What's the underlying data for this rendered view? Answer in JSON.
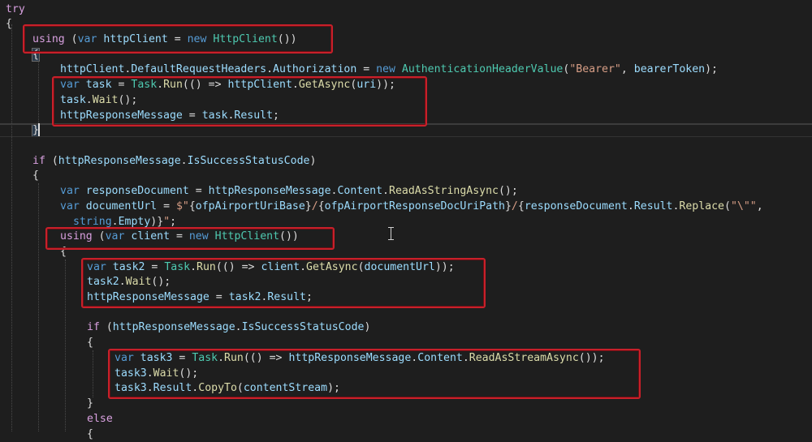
{
  "editor": {
    "lines": [
      [
        [
          "ctl",
          "try"
        ]
      ],
      [
        [
          "punc",
          "{"
        ]
      ],
      [
        [
          "ctl",
          "using"
        ],
        [
          "punc",
          " ("
        ],
        [
          "kw",
          "var"
        ],
        [
          "punc",
          " "
        ],
        [
          "var",
          "httpClient"
        ],
        [
          "punc",
          " = "
        ],
        [
          "kw",
          "new"
        ],
        [
          "punc",
          " "
        ],
        [
          "type",
          "HttpClient"
        ],
        [
          "punc",
          "())"
        ]
      ],
      [
        [
          "punc",
          "{"
        ]
      ],
      [
        [
          "var",
          "httpClient"
        ],
        [
          "punc",
          "."
        ],
        [
          "var",
          "DefaultRequestHeaders"
        ],
        [
          "punc",
          "."
        ],
        [
          "var",
          "Authorization"
        ],
        [
          "punc",
          " = "
        ],
        [
          "kw",
          "new"
        ],
        [
          "punc",
          " "
        ],
        [
          "type",
          "AuthenticationHeaderValue"
        ],
        [
          "punc",
          "("
        ],
        [
          "str",
          "\"Bearer\""
        ],
        [
          "punc",
          ", "
        ],
        [
          "var",
          "bearerToken"
        ],
        [
          "punc",
          ");"
        ]
      ],
      [
        [
          "kw",
          "var"
        ],
        [
          "punc",
          " "
        ],
        [
          "var",
          "task"
        ],
        [
          "punc",
          " = "
        ],
        [
          "type",
          "Task"
        ],
        [
          "punc",
          "."
        ],
        [
          "method",
          "Run"
        ],
        [
          "punc",
          "(() => "
        ],
        [
          "var",
          "httpClient"
        ],
        [
          "punc",
          "."
        ],
        [
          "method",
          "GetAsync"
        ],
        [
          "punc",
          "("
        ],
        [
          "var",
          "uri"
        ],
        [
          "punc",
          "));"
        ]
      ],
      [
        [
          "var",
          "task"
        ],
        [
          "punc",
          "."
        ],
        [
          "method",
          "Wait"
        ],
        [
          "punc",
          "();"
        ]
      ],
      [
        [
          "var",
          "httpResponseMessage"
        ],
        [
          "punc",
          " = "
        ],
        [
          "var",
          "task"
        ],
        [
          "punc",
          "."
        ],
        [
          "var",
          "Result"
        ],
        [
          "punc",
          ";"
        ]
      ],
      [
        [
          "punc",
          "}"
        ]
      ],
      [],
      [
        [
          "ctl",
          "if"
        ],
        [
          "punc",
          " ("
        ],
        [
          "var",
          "httpResponseMessage"
        ],
        [
          "punc",
          "."
        ],
        [
          "var",
          "IsSuccessStatusCode"
        ],
        [
          "punc",
          ")"
        ]
      ],
      [
        [
          "punc",
          "{"
        ]
      ],
      [
        [
          "kw",
          "var"
        ],
        [
          "punc",
          " "
        ],
        [
          "var",
          "responseDocument"
        ],
        [
          "punc",
          " = "
        ],
        [
          "var",
          "httpResponseMessage"
        ],
        [
          "punc",
          "."
        ],
        [
          "var",
          "Content"
        ],
        [
          "punc",
          "."
        ],
        [
          "method",
          "ReadAsStringAsync"
        ],
        [
          "punc",
          "();"
        ]
      ],
      [
        [
          "kw",
          "var"
        ],
        [
          "punc",
          " "
        ],
        [
          "var",
          "documentUrl"
        ],
        [
          "punc",
          " = "
        ],
        [
          "str",
          "$\""
        ],
        [
          "punc",
          "{"
        ],
        [
          "var",
          "ofpAirportUriBase"
        ],
        [
          "punc",
          "}"
        ],
        [
          "str",
          "/"
        ],
        [
          "punc",
          "{"
        ],
        [
          "var",
          "ofpAirportResponseDocUriPath"
        ],
        [
          "punc",
          "}"
        ],
        [
          "str",
          "/"
        ],
        [
          "punc",
          "{"
        ],
        [
          "var",
          "responseDocument"
        ],
        [
          "punc",
          "."
        ],
        [
          "var",
          "Result"
        ],
        [
          "punc",
          "."
        ],
        [
          "method",
          "Replace"
        ],
        [
          "punc",
          "("
        ],
        [
          "str",
          "\"\\\"\""
        ],
        [
          "punc",
          ","
        ]
      ],
      [
        [
          "kw",
          "string"
        ],
        [
          "punc",
          "."
        ],
        [
          "var",
          "Empty"
        ],
        [
          "punc",
          ")}"
        ],
        [
          "str",
          "\""
        ],
        [
          "punc",
          ";"
        ]
      ],
      [
        [
          "ctl",
          "using"
        ],
        [
          "punc",
          " ("
        ],
        [
          "kw",
          "var"
        ],
        [
          "punc",
          " "
        ],
        [
          "var",
          "client"
        ],
        [
          "punc",
          " = "
        ],
        [
          "kw",
          "new"
        ],
        [
          "punc",
          " "
        ],
        [
          "type",
          "HttpClient"
        ],
        [
          "punc",
          "())"
        ]
      ],
      [
        [
          "punc",
          "{"
        ]
      ],
      [
        [
          "kw",
          "var"
        ],
        [
          "punc",
          " "
        ],
        [
          "var",
          "task2"
        ],
        [
          "punc",
          " = "
        ],
        [
          "type",
          "Task"
        ],
        [
          "punc",
          "."
        ],
        [
          "method",
          "Run"
        ],
        [
          "punc",
          "(() => "
        ],
        [
          "var",
          "client"
        ],
        [
          "punc",
          "."
        ],
        [
          "method",
          "GetAsync"
        ],
        [
          "punc",
          "("
        ],
        [
          "var",
          "documentUrl"
        ],
        [
          "punc",
          "));"
        ]
      ],
      [
        [
          "var",
          "task2"
        ],
        [
          "punc",
          "."
        ],
        [
          "method",
          "Wait"
        ],
        [
          "punc",
          "();"
        ]
      ],
      [
        [
          "var",
          "httpResponseMessage"
        ],
        [
          "punc",
          " = "
        ],
        [
          "var",
          "task2"
        ],
        [
          "punc",
          "."
        ],
        [
          "var",
          "Result"
        ],
        [
          "punc",
          ";"
        ]
      ],
      [],
      [
        [
          "ctl",
          "if"
        ],
        [
          "punc",
          " ("
        ],
        [
          "var",
          "httpResponseMessage"
        ],
        [
          "punc",
          "."
        ],
        [
          "var",
          "IsSuccessStatusCode"
        ],
        [
          "punc",
          ")"
        ]
      ],
      [
        [
          "punc",
          "{"
        ]
      ],
      [
        [
          "kw",
          "var"
        ],
        [
          "punc",
          " "
        ],
        [
          "var",
          "task3"
        ],
        [
          "punc",
          " = "
        ],
        [
          "type",
          "Task"
        ],
        [
          "punc",
          "."
        ],
        [
          "method",
          "Run"
        ],
        [
          "punc",
          "(() => "
        ],
        [
          "var",
          "httpResponseMessage"
        ],
        [
          "punc",
          "."
        ],
        [
          "var",
          "Content"
        ],
        [
          "punc",
          "."
        ],
        [
          "method",
          "ReadAsStreamAsync"
        ],
        [
          "punc",
          "());"
        ]
      ],
      [
        [
          "var",
          "task3"
        ],
        [
          "punc",
          "."
        ],
        [
          "method",
          "Wait"
        ],
        [
          "punc",
          "();"
        ]
      ],
      [
        [
          "var",
          "task3"
        ],
        [
          "punc",
          "."
        ],
        [
          "var",
          "Result"
        ],
        [
          "punc",
          "."
        ],
        [
          "method",
          "CopyTo"
        ],
        [
          "punc",
          "("
        ],
        [
          "var",
          "contentStream"
        ],
        [
          "punc",
          ");"
        ]
      ],
      [
        [
          "punc",
          "}"
        ]
      ],
      [
        [
          "ctl",
          "else"
        ]
      ],
      [
        [
          "punc",
          "{"
        ]
      ]
    ]
  },
  "colors": {
    "highlight_box": "#c8202a",
    "background": "#1e1e1e"
  }
}
